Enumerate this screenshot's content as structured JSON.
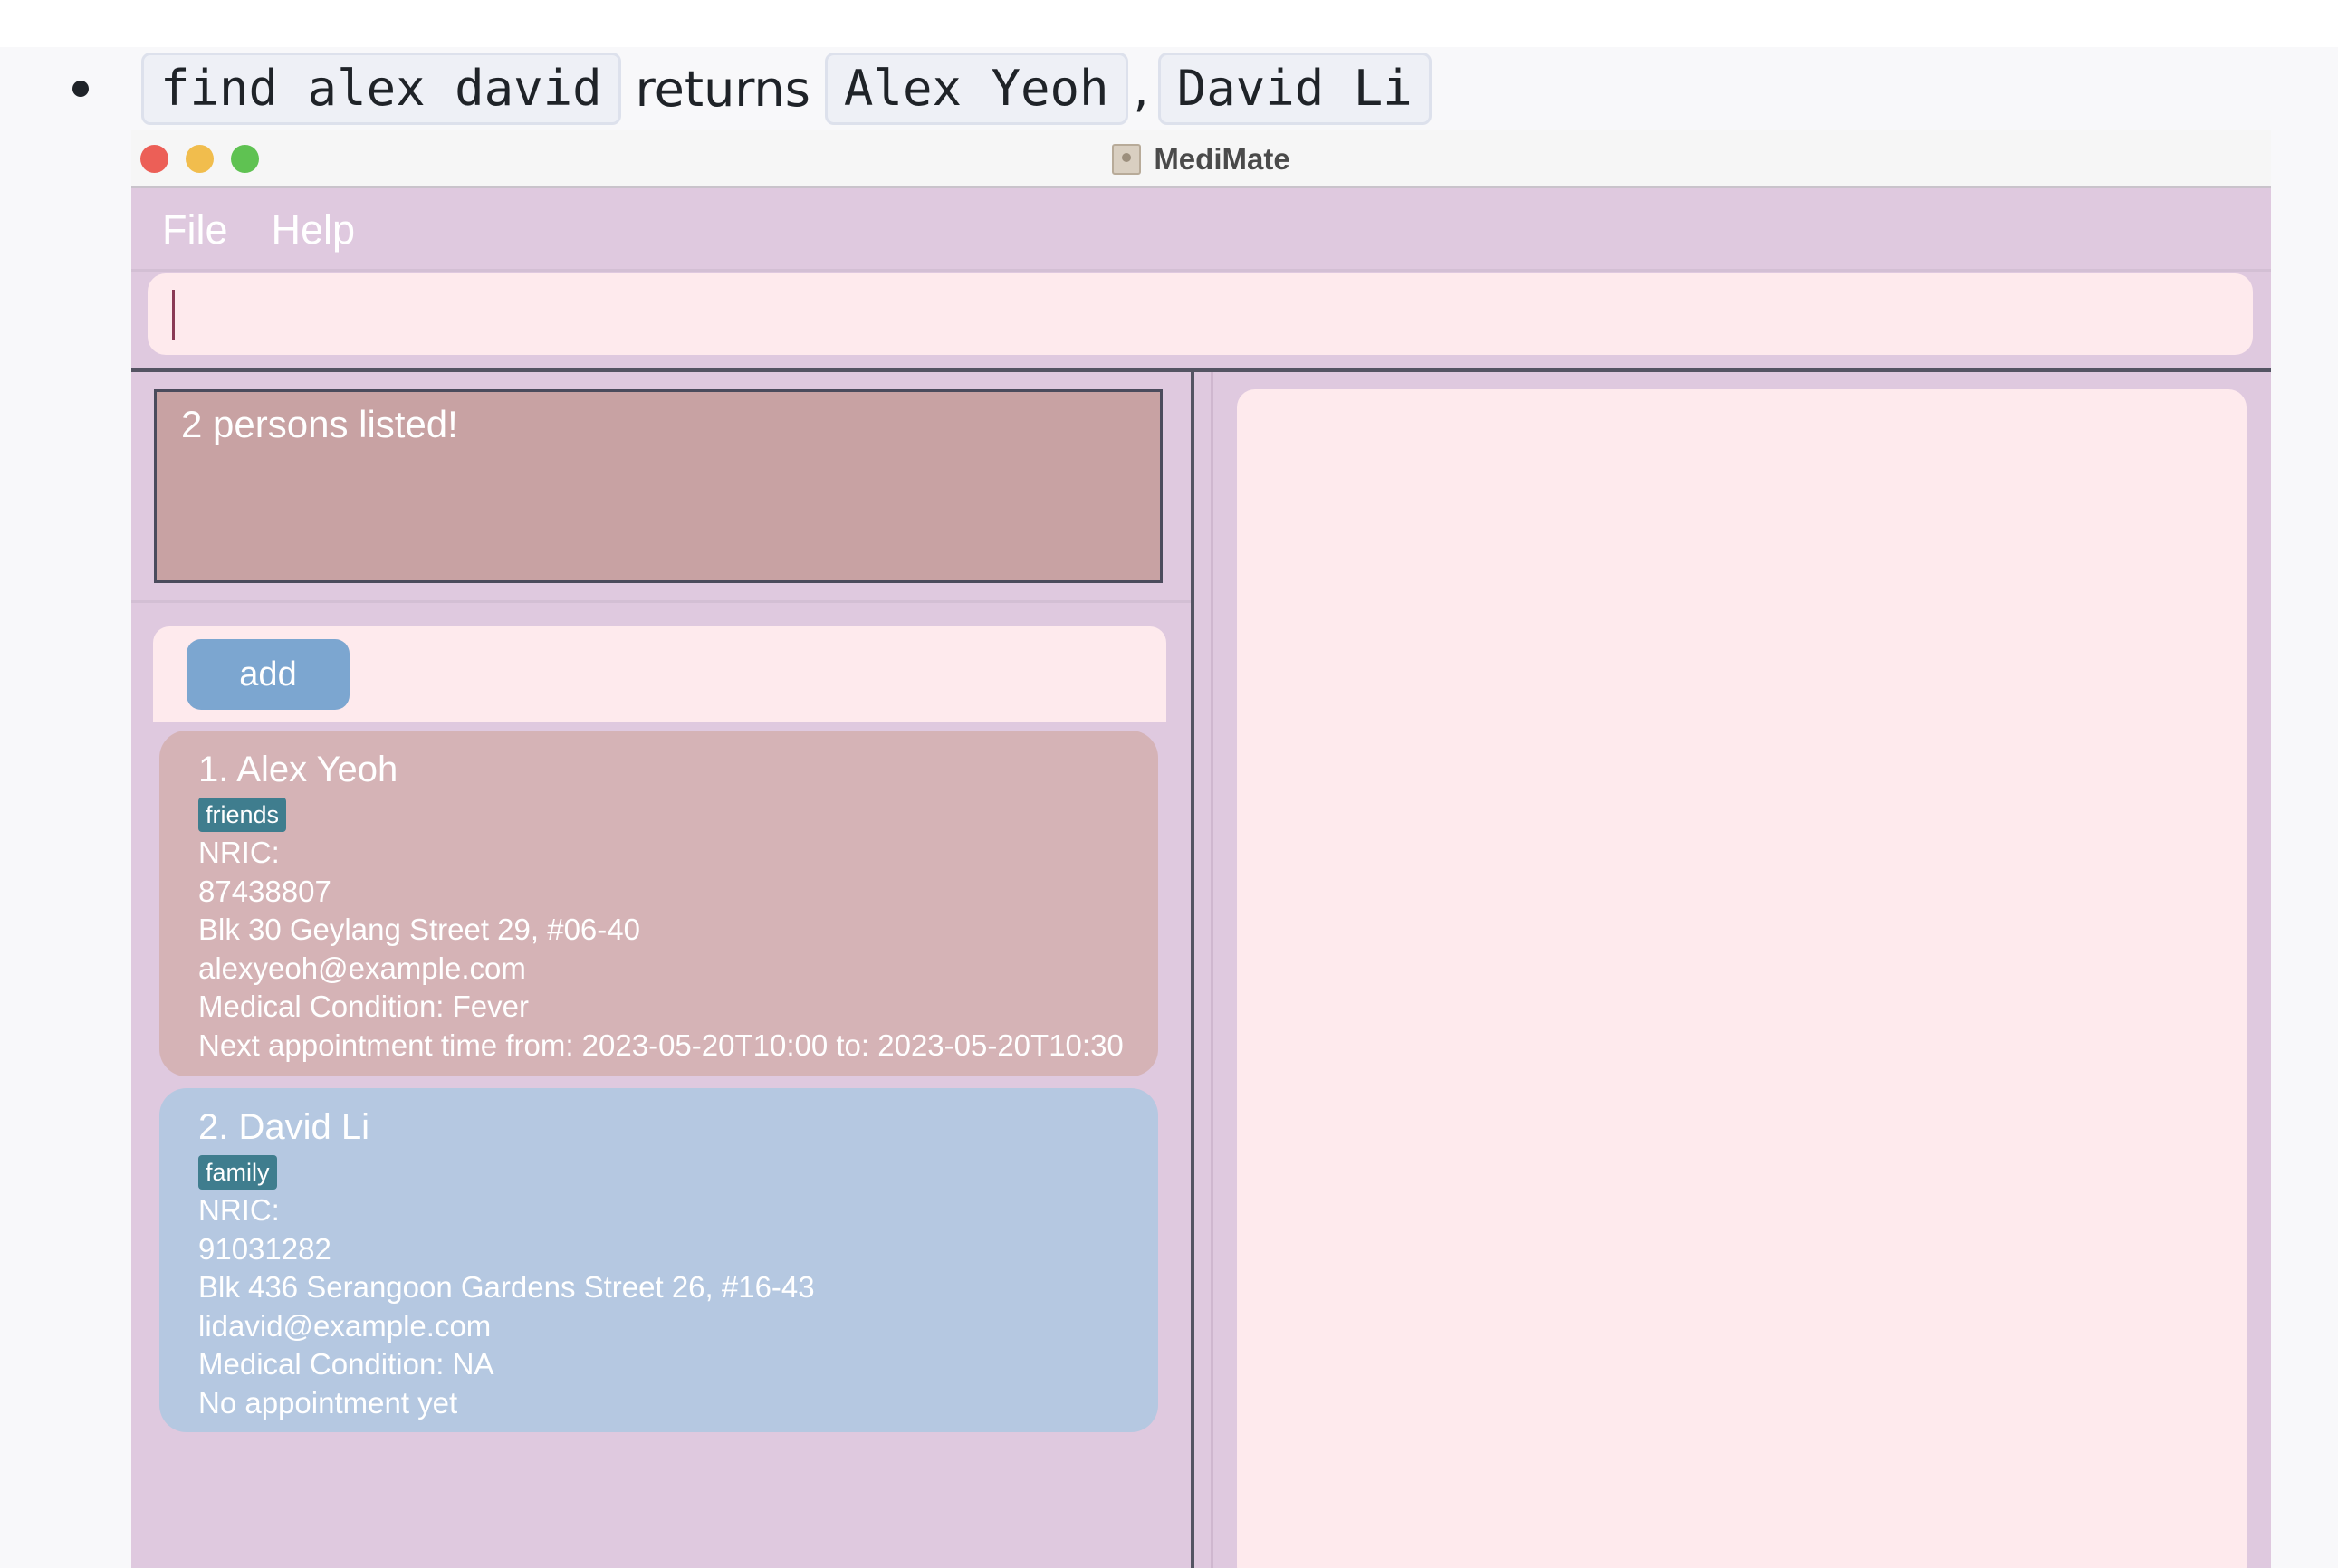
{
  "doc": {
    "command": "find alex david",
    "returns_text": "returns",
    "result_1": "Alex Yeoh",
    "separator": ",",
    "result_2": "David Li"
  },
  "window": {
    "title": "MediMate"
  },
  "menu": {
    "file": "File",
    "help": "Help"
  },
  "command_input": {
    "value": ""
  },
  "result_display": {
    "text": "2 persons listed!"
  },
  "add_button": {
    "label": "add"
  },
  "persons": [
    {
      "index_name": "1.  Alex Yeoh",
      "tag": "friends",
      "nric": "NRIC:",
      "phone": "87438807",
      "address": "Blk 30 Geylang Street 29, #06-40",
      "email": "alexyeoh@example.com",
      "medical": "Medical Condition: Fever",
      "appointment": "Next appointment time from: 2023-05-20T10:00 to: 2023-05-20T10:30",
      "color": "#d5b3b6"
    },
    {
      "index_name": "2.  David Li",
      "tag": "family",
      "nric": "NRIC:",
      "phone": "91031282",
      "address": "Blk 436 Serangoon Gardens Street 26, #16-43",
      "email": "lidavid@example.com",
      "medical": "Medical Condition: NA",
      "appointment": "No appointment yet",
      "color": "#b5c8e1"
    }
  ],
  "colors": {
    "window_bg": "#dfc9df",
    "input_bg": "#feeaed",
    "result_bg": "#c8a2a3",
    "button": "#7ca6d0",
    "tag": "#3f7d8e"
  }
}
